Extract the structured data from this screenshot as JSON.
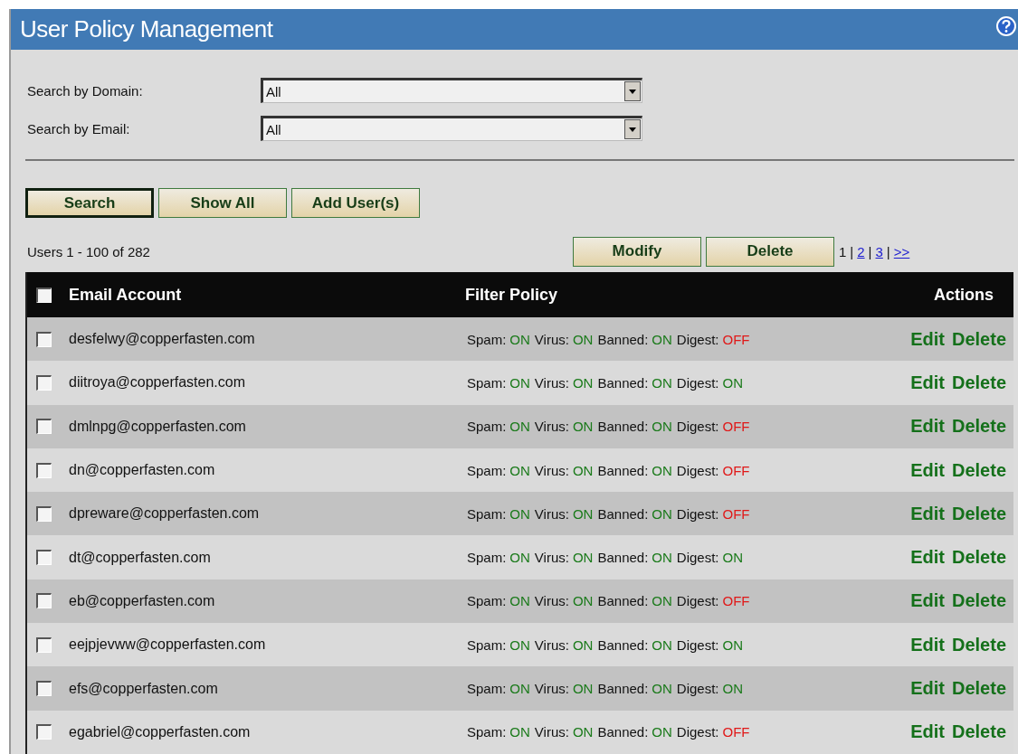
{
  "window": {
    "title": "User Policy Management"
  },
  "filters": [
    {
      "label": "Search by Domain:",
      "value": "All"
    },
    {
      "label": "Search by Email:",
      "value": "All"
    }
  ],
  "buttons": [
    {
      "label": "Search",
      "selected": true
    },
    {
      "label": "Show All",
      "selected": false
    },
    {
      "label": "Add User(s)",
      "selected": false
    }
  ],
  "summary": "Users 1 - 100 of 282",
  "bulk_buttons": [
    "Modify",
    "Delete"
  ],
  "pagination": {
    "separator": "|",
    "pages": [
      {
        "label": "1",
        "selected": true
      },
      {
        "label": "2",
        "selected": false
      },
      {
        "label": "3",
        "selected": false
      },
      {
        "label": ">>",
        "selected": false
      }
    ]
  },
  "table": {
    "select_all_checked": false,
    "columns": [
      "Email Account",
      "Filter Policy",
      "Actions"
    ],
    "rows": [
      {
        "checked": false,
        "email": "desfelwy@copperfasten.com",
        "policy": [
          {
            "label": "Spam:",
            "value": "ON",
            "on": true
          },
          {
            "label": "Virus:",
            "value": "ON",
            "on": true
          },
          {
            "label": "Banned:",
            "value": "ON",
            "on": true
          },
          {
            "label": "Digest:",
            "value": "OFF",
            "on": false
          }
        ],
        "actions": [
          "Edit",
          "Delete"
        ]
      },
      {
        "checked": false,
        "email": "diitroya@copperfasten.com",
        "policy": [
          {
            "label": "Spam:",
            "value": "ON",
            "on": true
          },
          {
            "label": "Virus:",
            "value": "ON",
            "on": true
          },
          {
            "label": "Banned:",
            "value": "ON",
            "on": true
          },
          {
            "label": "Digest:",
            "value": "ON",
            "on": true
          }
        ],
        "actions": [
          "Edit",
          "Delete"
        ]
      },
      {
        "checked": false,
        "email": "dmlnpg@copperfasten.com",
        "policy": [
          {
            "label": "Spam:",
            "value": "ON",
            "on": true
          },
          {
            "label": "Virus:",
            "value": "ON",
            "on": true
          },
          {
            "label": "Banned:",
            "value": "ON",
            "on": true
          },
          {
            "label": "Digest:",
            "value": "OFF",
            "on": false
          }
        ],
        "actions": [
          "Edit",
          "Delete"
        ]
      },
      {
        "checked": false,
        "email": "dn@copperfasten.com",
        "policy": [
          {
            "label": "Spam:",
            "value": "ON",
            "on": true
          },
          {
            "label": "Virus:",
            "value": "ON",
            "on": true
          },
          {
            "label": "Banned:",
            "value": "ON",
            "on": true
          },
          {
            "label": "Digest:",
            "value": "OFF",
            "on": false
          }
        ],
        "actions": [
          "Edit",
          "Delete"
        ]
      },
      {
        "checked": false,
        "email": "dpreware@copperfasten.com",
        "policy": [
          {
            "label": "Spam:",
            "value": "ON",
            "on": true
          },
          {
            "label": "Virus:",
            "value": "ON",
            "on": true
          },
          {
            "label": "Banned:",
            "value": "ON",
            "on": true
          },
          {
            "label": "Digest:",
            "value": "OFF",
            "on": false
          }
        ],
        "actions": [
          "Edit",
          "Delete"
        ]
      },
      {
        "checked": false,
        "email": "dt@copperfasten.com",
        "policy": [
          {
            "label": "Spam:",
            "value": "ON",
            "on": true
          },
          {
            "label": "Virus:",
            "value": "ON",
            "on": true
          },
          {
            "label": "Banned:",
            "value": "ON",
            "on": true
          },
          {
            "label": "Digest:",
            "value": "ON",
            "on": true
          }
        ],
        "actions": [
          "Edit",
          "Delete"
        ]
      },
      {
        "checked": false,
        "email": "eb@copperfasten.com",
        "policy": [
          {
            "label": "Spam:",
            "value": "ON",
            "on": true
          },
          {
            "label": "Virus:",
            "value": "ON",
            "on": true
          },
          {
            "label": "Banned:",
            "value": "ON",
            "on": true
          },
          {
            "label": "Digest:",
            "value": "OFF",
            "on": false
          }
        ],
        "actions": [
          "Edit",
          "Delete"
        ]
      },
      {
        "checked": false,
        "email": "eejpjevww@copperfasten.com",
        "policy": [
          {
            "label": "Spam:",
            "value": "ON",
            "on": true
          },
          {
            "label": "Virus:",
            "value": "ON",
            "on": true
          },
          {
            "label": "Banned:",
            "value": "ON",
            "on": true
          },
          {
            "label": "Digest:",
            "value": "ON",
            "on": true
          }
        ],
        "actions": [
          "Edit",
          "Delete"
        ]
      },
      {
        "checked": false,
        "email": "efs@copperfasten.com",
        "policy": [
          {
            "label": "Spam:",
            "value": "ON",
            "on": true
          },
          {
            "label": "Virus:",
            "value": "ON",
            "on": true
          },
          {
            "label": "Banned:",
            "value": "ON",
            "on": true
          },
          {
            "label": "Digest:",
            "value": "ON",
            "on": true
          }
        ],
        "actions": [
          "Edit",
          "Delete"
        ]
      },
      {
        "checked": false,
        "email": "egabriel@copperfasten.com",
        "policy": [
          {
            "label": "Spam:",
            "value": "ON",
            "on": true
          },
          {
            "label": "Virus:",
            "value": "ON",
            "on": true
          },
          {
            "label": "Banned:",
            "value": "ON",
            "on": true
          },
          {
            "label": "Digest:",
            "value": "OFF",
            "on": false
          }
        ],
        "actions": [
          "Edit",
          "Delete"
        ]
      }
    ]
  }
}
